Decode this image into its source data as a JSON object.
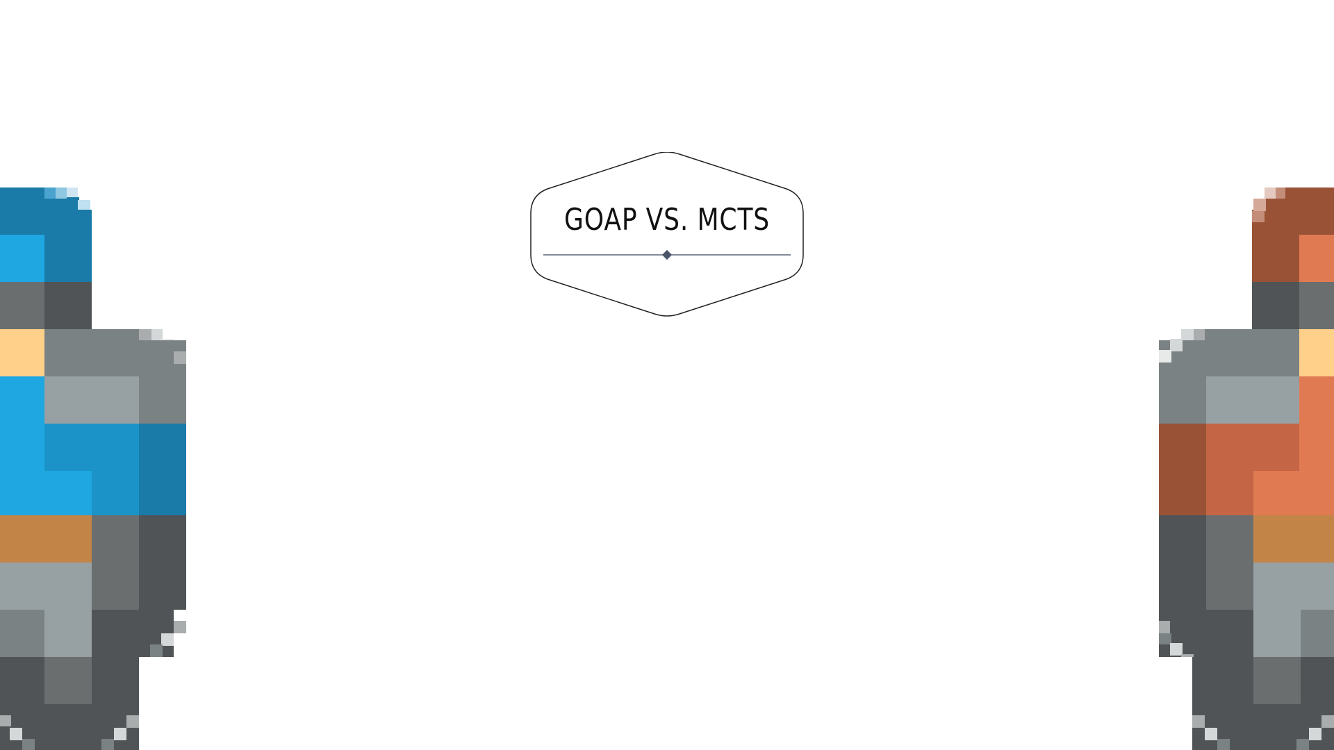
{
  "slide": {
    "title": "GOAP VS. MCTS"
  },
  "characters": {
    "left": {
      "icon": "blue-knight-icon",
      "accent": "#1ea7e1"
    },
    "right": {
      "icon": "orange-knight-icon",
      "accent": "#e07a52"
    }
  },
  "colors": {
    "background": "#ffffff",
    "badge_outline": "#222222",
    "divider": "#5a6478"
  }
}
